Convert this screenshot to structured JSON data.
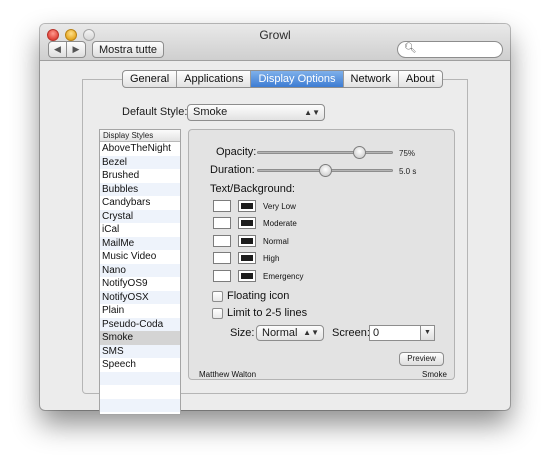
{
  "window": {
    "title": "Growl"
  },
  "toolbar": {
    "back_icon": "back-arrow-icon",
    "forward_icon": "forward-arrow-icon",
    "show_all_label": "Mostra tutte",
    "search_icon": "search-icon",
    "search_value": ""
  },
  "tabs": [
    {
      "label": "General",
      "active": false
    },
    {
      "label": "Applications",
      "active": false
    },
    {
      "label": "Display Options",
      "active": true
    },
    {
      "label": "Network",
      "active": false
    },
    {
      "label": "About",
      "active": false
    }
  ],
  "default_style": {
    "label": "Default Style:",
    "value": "Smoke"
  },
  "styles_list": {
    "header": "Display Styles",
    "items": [
      "AboveTheNight",
      "Bezel",
      "Brushed",
      "Bubbles",
      "Candybars",
      "Crystal",
      "iCal",
      "MailMe",
      "Music Video",
      "Nano",
      "NotifyOS9",
      "NotifyOSX",
      "Plain",
      "Pseudo-Coda",
      "Smoke",
      "SMS",
      "Speech",
      "",
      "",
      ""
    ],
    "selected": "Smoke"
  },
  "settings": {
    "opacity_label": "Opacity:",
    "opacity_value": "75%",
    "opacity_fraction": 0.75,
    "duration_label": "Duration:",
    "duration_value": "5.0 s",
    "duration_fraction": 0.5,
    "text_bg_label": "Text/Background:",
    "priorities": [
      "Very Low",
      "Moderate",
      "Normal",
      "High",
      "Emergency"
    ],
    "floating_icon_label": "Floating icon",
    "floating_icon_checked": false,
    "limit_lines_label": "Limit to 2-5 lines",
    "limit_lines_checked": false,
    "size_label": "Size:",
    "size_value": "Normal",
    "screen_label": "Screen:",
    "screen_value": "0",
    "preview_label": "Preview",
    "author": "Matthew Walton",
    "style_name": "Smoke"
  },
  "colors": {
    "selected_tab": "#3d7cd3",
    "list_alt_row": "#eef3fb",
    "list_selected_row": "#d4d4d4"
  }
}
